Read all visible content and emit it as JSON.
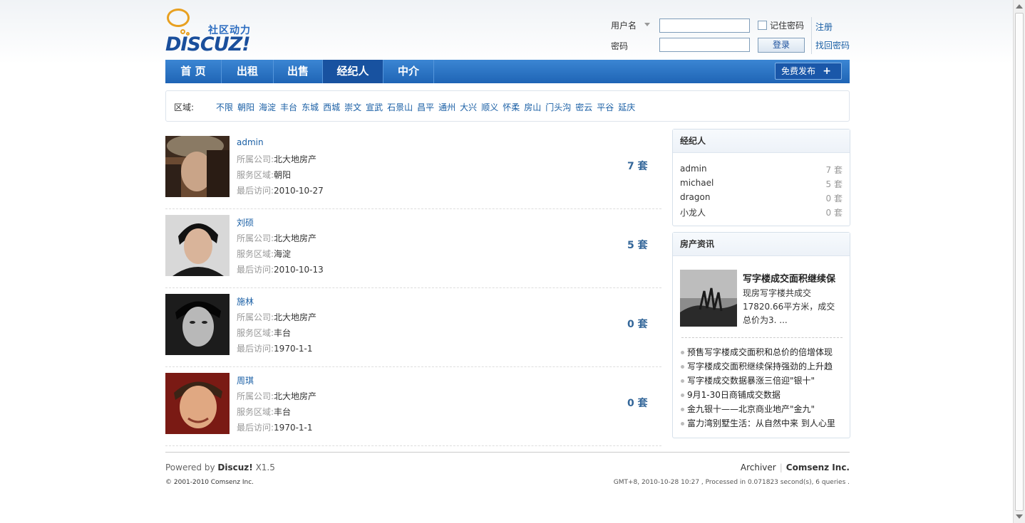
{
  "logo": {
    "text": "DISCUZ!",
    "slogan": "社区动力"
  },
  "login": {
    "username_label": "用户名",
    "password_label": "密码",
    "remember_label": "记住密码",
    "login_button": "登录",
    "register_link": "注册",
    "forgot_link": "找回密码"
  },
  "nav": {
    "items": [
      "首 页",
      "出租",
      "出售",
      "经纪人",
      "中介"
    ],
    "active": "经纪人",
    "post_button": "免费发布",
    "post_plus": "+"
  },
  "areas": {
    "label": "区域:",
    "items": [
      "不限",
      "朝阳",
      "海淀",
      "丰台",
      "东城",
      "西城",
      "崇文",
      "宣武",
      "石景山",
      "昌平",
      "通州",
      "大兴",
      "顺义",
      "怀柔",
      "房山",
      "门头沟",
      "密云",
      "平谷",
      "延庆"
    ]
  },
  "agents": [
    {
      "name": "admin",
      "company_label": "所属公司:",
      "company": "北大地房产",
      "region_label": "服务区域:",
      "region": "朝阳",
      "visit_label": "最后访问:",
      "visit": "2010-10-27",
      "count": "7 套"
    },
    {
      "name": "刘硕",
      "company_label": "所属公司:",
      "company": "北大地房产",
      "region_label": "服务区域:",
      "region": "海淀",
      "visit_label": "最后访问:",
      "visit": "2010-10-13",
      "count": "5 套"
    },
    {
      "name": "施林",
      "company_label": "所属公司:",
      "company": "北大地房产",
      "region_label": "服务区域:",
      "region": "丰台",
      "visit_label": "最后访问:",
      "visit": "1970-1-1",
      "count": "0 套"
    },
    {
      "name": "周琪",
      "company_label": "所属公司:",
      "company": "北大地房产",
      "region_label": "服务区域:",
      "region": "丰台",
      "visit_label": "最后访问:",
      "visit": "1970-1-1",
      "count": "0 套"
    }
  ],
  "sidebar": {
    "agents_title": "经纪人",
    "agents_stats": [
      {
        "name": "admin",
        "count": "7 套"
      },
      {
        "name": "michael",
        "count": "5 套"
      },
      {
        "name": "dragon",
        "count": "0 套"
      },
      {
        "name": "小龙人",
        "count": "0 套"
      }
    ],
    "news_title": "房产资讯",
    "featured": {
      "title": "写字楼成交面积继续保",
      "desc": "现房写字楼共成交17820.66平方米，成交总价为3. ..."
    },
    "news": [
      "预售写字楼成交面积和总价的倍增体现",
      "写字楼成交面积继续保持强劲的上升趋",
      "写字楼成交数据暴涨三倍迎\"银十\"",
      "9月1-30日商铺成交数据",
      "金九银十——北京商业地产\"金九\"",
      "富力湾别墅生活：从自然中来 到人心里"
    ]
  },
  "footer": {
    "powered_prefix": "Powered by",
    "powered_brand": "Discuz!",
    "powered_version": "X1.5",
    "copyright": "© 2001-2010 Comsenz Inc.",
    "archiver": "Archiver",
    "company": "Comsenz Inc.",
    "info": "GMT+8, 2010-10-28 10:27 , Processed in 0.071823 second(s), 6 queries ."
  }
}
